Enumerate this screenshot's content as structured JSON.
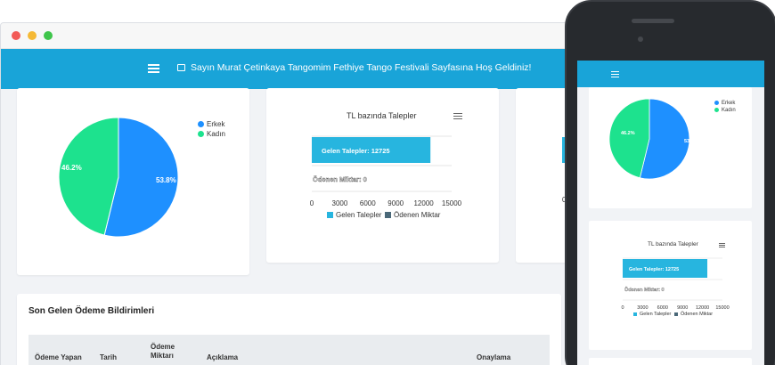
{
  "header": {
    "welcome_text": "Sayın Murat Çetinkaya Tangomim Fethiye Tango Festivali Sayfasına Hoş Geldiniz!"
  },
  "pie_chart": {
    "legend": [
      {
        "label": "Erkek",
        "color": "#1e90ff"
      },
      {
        "label": "Kadın",
        "color": "#1de28e"
      }
    ],
    "slice_labels": [
      "53.8%",
      "46.2%"
    ]
  },
  "bar_chart": {
    "title": "TL bazında Talepler",
    "bar_labels": [
      "Gelen Talepler: 12725",
      "Ödenen Miktar: 0"
    ],
    "ticks": [
      "0",
      "3000",
      "6000",
      "9000",
      "12000",
      "15000"
    ],
    "legend": [
      {
        "label": "Gelen Talepler",
        "color": "#27b5df"
      },
      {
        "label": "Ödenen Miktar",
        "color": "#4a6878"
      }
    ]
  },
  "payments_table": {
    "title": "Son Gelen Ödeme Bildirimleri",
    "columns": [
      "Ödeme Yapan",
      "Tarih",
      "Ödeme Miktarı",
      "Açıklama",
      "Onaylama"
    ]
  },
  "chart_data": [
    {
      "type": "pie",
      "categories": [
        "Erkek",
        "Kadın"
      ],
      "values": [
        53.8,
        46.2
      ]
    },
    {
      "type": "bar",
      "title": "TL bazında Talepler",
      "categories": [
        "Gelen Talepler",
        "Ödenen Miktar"
      ],
      "values": [
        12725,
        0
      ],
      "xlim": [
        0,
        15000
      ],
      "legend": "bottom"
    }
  ],
  "colors": {
    "topbar": "#19a4d8",
    "male": "#1e90ff",
    "female": "#1de28e",
    "bar": "#27b5df"
  }
}
